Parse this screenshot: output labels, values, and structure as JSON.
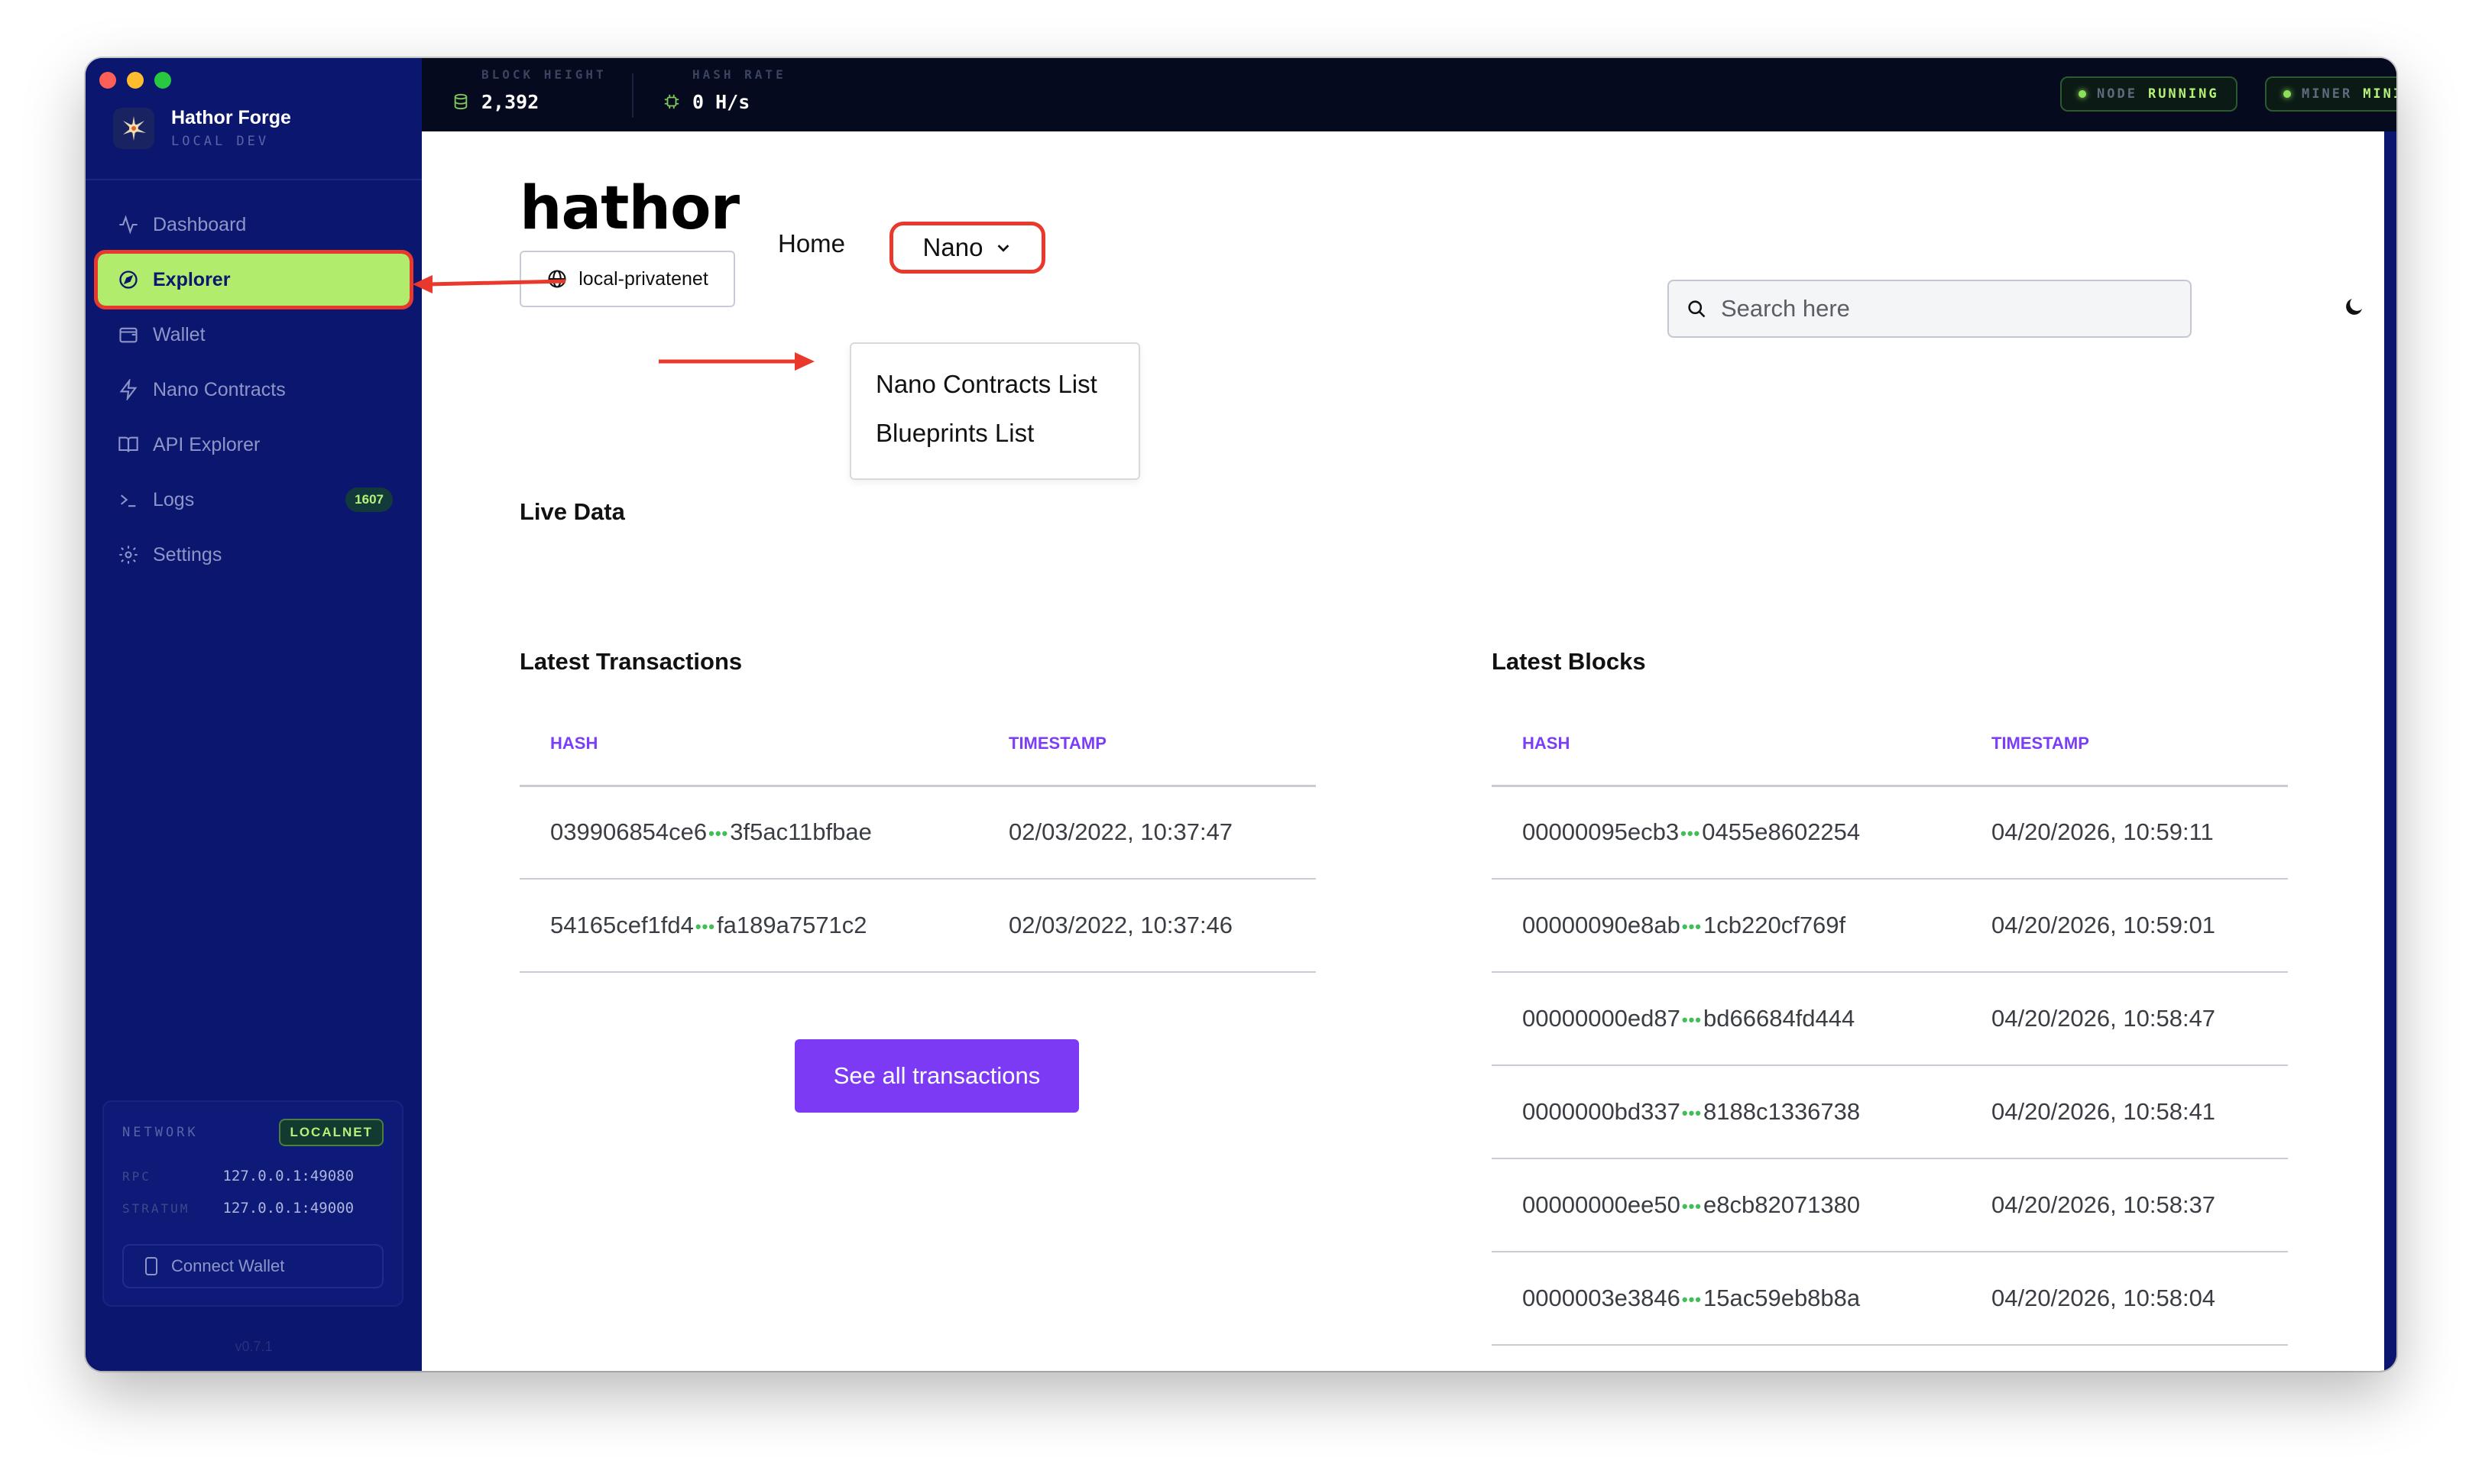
{
  "app": {
    "title": "Hathor Forge",
    "subtitle": "LOCAL DEV",
    "version": "v0.7.1"
  },
  "topbar": {
    "block_height_label": "BLOCK HEIGHT",
    "block_height_value": "2,392",
    "hash_rate_label": "HASH RATE",
    "hash_rate_value": "0 H/s",
    "node_label": "NODE",
    "node_status": "RUNNING",
    "miner_label": "MINER",
    "miner_status": "MINING"
  },
  "sidebar": {
    "items": [
      {
        "label": "Dashboard",
        "icon": "activity-icon"
      },
      {
        "label": "Explorer",
        "icon": "compass-icon",
        "active": true
      },
      {
        "label": "Wallet",
        "icon": "wallet-icon"
      },
      {
        "label": "Nano Contracts",
        "icon": "zap-icon"
      },
      {
        "label": "API Explorer",
        "icon": "book-icon"
      },
      {
        "label": "Logs",
        "icon": "terminal-icon",
        "badge": "1607"
      },
      {
        "label": "Settings",
        "icon": "gear-icon"
      }
    ],
    "network": {
      "label": "NETWORK",
      "badge": "LOCALNET",
      "rpc_label": "RPC",
      "rpc_value": "127.0.0.1:49080",
      "stratum_label": "STRATUM",
      "stratum_value": "127.0.0.1:49000",
      "connect_label": "Connect Wallet"
    }
  },
  "explorer": {
    "logo": "hathor",
    "network_selector": "local-privatenet",
    "nav_home": "Home",
    "nav_nano": "Nano",
    "dropdown": [
      "Nano Contracts List",
      "Blueprints List"
    ],
    "search_placeholder": "Search here",
    "live_data": "Live Data",
    "transactions": {
      "title": "Latest Transactions",
      "headers": [
        "HASH",
        "TIMESTAMP"
      ],
      "rows": [
        {
          "hash_start": "039906854ce6",
          "hash_end": "3f5ac11bfbae",
          "timestamp": "02/03/2022, 10:37:47"
        },
        {
          "hash_start": "54165cef1fd4",
          "hash_end": "fa189a7571c2",
          "timestamp": "02/03/2022, 10:37:46"
        }
      ],
      "button": "See all transactions"
    },
    "blocks": {
      "title": "Latest Blocks",
      "headers": [
        "HASH",
        "TIMESTAMP"
      ],
      "rows": [
        {
          "hash_start": "00000095ecb3",
          "hash_end": "0455e8602254",
          "timestamp": "04/20/2026, 10:59:11"
        },
        {
          "hash_start": "00000090e8ab",
          "hash_end": "1cb220cf769f",
          "timestamp": "04/20/2026, 10:59:01"
        },
        {
          "hash_start": "00000000ed87",
          "hash_end": "bd66684fd444",
          "timestamp": "04/20/2026, 10:58:47"
        },
        {
          "hash_start": "0000000bd337",
          "hash_end": "8188c1336738",
          "timestamp": "04/20/2026, 10:58:41"
        },
        {
          "hash_start": "00000000ee50",
          "hash_end": "e8cb82071380",
          "timestamp": "04/20/2026, 10:58:37"
        },
        {
          "hash_start": "0000003e3846",
          "hash_end": "15ac59eb8b8a",
          "timestamp": "04/20/2026, 10:58:04"
        }
      ]
    }
  },
  "colors": {
    "sidebar_bg": "#0b166e",
    "active_item": "#b2ec6c",
    "accent_purple": "#7d3af5",
    "annotation_red": "#e8392c",
    "status_green": "#b6f277"
  }
}
